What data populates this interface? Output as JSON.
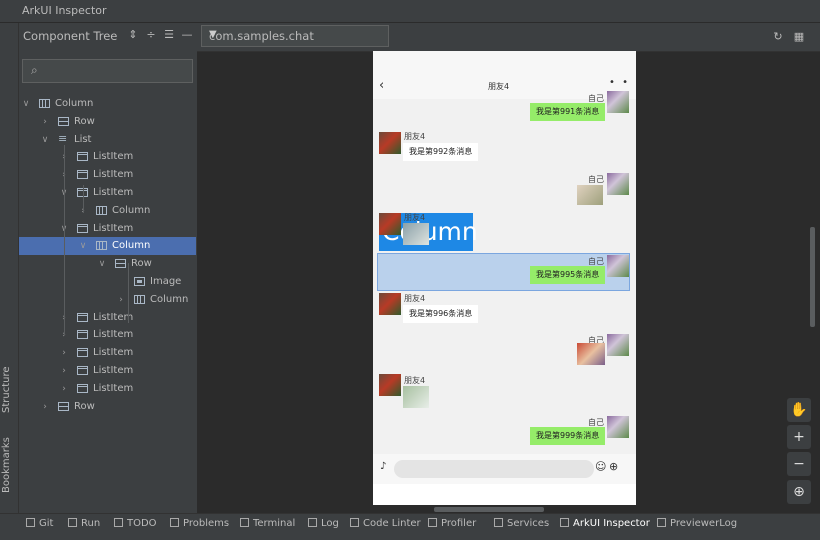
{
  "window": {
    "title": "ArkUI Inspector"
  },
  "left_strip": {
    "structure": "Structure",
    "bookmarks": "Bookmarks"
  },
  "component_tree": {
    "title": "Component Tree",
    "search_placeholder": "",
    "nodes": [
      {
        "label": "Column",
        "icon": "column-icon",
        "expanded": true
      },
      {
        "label": "Row",
        "icon": "row-icon",
        "expanded": false
      },
      {
        "label": "List",
        "icon": "list-icon",
        "expanded": true
      },
      {
        "label": "ListItem",
        "icon": "listitem-icon",
        "expanded": false
      },
      {
        "label": "ListItem",
        "icon": "listitem-icon",
        "expanded": false
      },
      {
        "label": "ListItem",
        "icon": "listitem-icon",
        "expanded": true
      },
      {
        "label": "Column",
        "icon": "column-icon",
        "expanded": false
      },
      {
        "label": "ListItem",
        "icon": "listitem-icon",
        "expanded": true
      },
      {
        "label": "Column",
        "icon": "column-icon",
        "expanded": true,
        "selected": true
      },
      {
        "label": "Row",
        "icon": "row-icon",
        "expanded": true
      },
      {
        "label": "Image",
        "icon": "image-icon",
        "expanded": false
      },
      {
        "label": "Column",
        "icon": "column-icon",
        "expanded": false
      },
      {
        "label": "ListItem",
        "icon": "listitem-icon",
        "expanded": false
      },
      {
        "label": "ListItem",
        "icon": "listitem-icon",
        "expanded": false
      },
      {
        "label": "ListItem",
        "icon": "listitem-icon",
        "expanded": false
      },
      {
        "label": "ListItem",
        "icon": "listitem-icon",
        "expanded": false
      },
      {
        "label": "ListItem",
        "icon": "listitem-icon",
        "expanded": false
      },
      {
        "label": "Row",
        "icon": "row-icon",
        "expanded": false
      }
    ]
  },
  "toolbar": {
    "app_selector": "com.samples.chat"
  },
  "phone": {
    "header_title": "朋友4",
    "messages": [
      {
        "from": "self",
        "name": "自己",
        "text": "我是第991条消息"
      },
      {
        "from": "friend",
        "name": "朋友4",
        "text": "我是第992条消息"
      },
      {
        "from": "self",
        "name": "自己",
        "text": ""
      },
      {
        "from": "friend",
        "name": "朋友4",
        "text": ""
      },
      {
        "from": "self",
        "name": "自己",
        "text": "我是第995条消息"
      },
      {
        "from": "friend",
        "name": "朋友4",
        "text": "我是第996条消息"
      },
      {
        "from": "self",
        "name": "自己",
        "text": ""
      },
      {
        "from": "friend",
        "name": "朋友4",
        "text": ""
      },
      {
        "from": "self",
        "name": "自己",
        "text": "我是第999条消息"
      }
    ],
    "highlight_label": "Column"
  },
  "bottom_tabs": [
    {
      "label": "Git",
      "icon": "git-icon"
    },
    {
      "label": "Run",
      "icon": "run-icon"
    },
    {
      "label": "TODO",
      "icon": "todo-icon"
    },
    {
      "label": "Problems",
      "icon": "problems-icon"
    },
    {
      "label": "Terminal",
      "icon": "terminal-icon"
    },
    {
      "label": "Log",
      "icon": "log-icon"
    },
    {
      "label": "Code Linter",
      "icon": "code-linter-icon"
    },
    {
      "label": "Profiler",
      "icon": "profiler-icon"
    },
    {
      "label": "Services",
      "icon": "services-icon"
    },
    {
      "label": "ArkUI Inspector",
      "icon": "arkui-inspector-icon",
      "active": true
    },
    {
      "label": "PreviewerLog",
      "icon": "previewer-log-icon"
    }
  ],
  "colors": {
    "selection": "#4b6eaf",
    "highlight": "#1e88e5",
    "bubble_self": "#95ec69"
  }
}
